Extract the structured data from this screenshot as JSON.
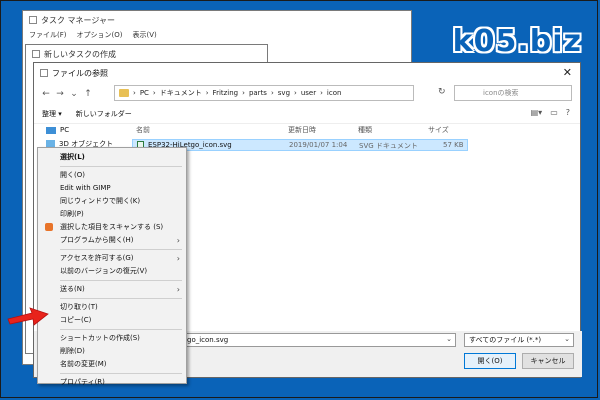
{
  "brand": "k05.biz",
  "task_manager": {
    "title": "タスク マネージャー",
    "menu": [
      "ファイル(F)",
      "オプション(O)",
      "表示(V)"
    ]
  },
  "new_task": {
    "title": "新しいタスクの作成"
  },
  "dialog": {
    "title": "ファイルの参照",
    "breadcrumb": [
      "PC",
      "ドキュメント",
      "Fritzing",
      "parts",
      "svg",
      "user",
      "icon"
    ],
    "search_placeholder": "iconの検索",
    "toolbar": {
      "organize": "整理 ▾",
      "new_folder": "新しいフォルダー"
    },
    "nav": [
      {
        "label": "PC",
        "icon": "pc-icon"
      },
      {
        "label": "3D オブジェクト",
        "icon": "3d-objects-icon"
      }
    ],
    "columns": {
      "name": "名前",
      "date": "更新日時",
      "type": "種類",
      "size": "サイズ"
    },
    "files": [
      {
        "name": "ESP32-HiLetgo_icon.svg",
        "date": "2019/01/07 1:04",
        "type": "SVG ドキュメント",
        "size": "57 KB"
      }
    ],
    "filename_value": "go_icon.svg",
    "filetype": "すべてのファイル (*.*)",
    "open_label": "開く(O)",
    "cancel_label": "キャンセル"
  },
  "context_menu": {
    "items": [
      {
        "label": "選択(L)",
        "bold": true
      },
      {
        "sep": true
      },
      {
        "label": "開く(O)"
      },
      {
        "label": "Edit with GIMP"
      },
      {
        "label": "同じウィンドウで開く(K)"
      },
      {
        "label": "印刷(P)"
      },
      {
        "label": "選択した項目をスキャンする (S)",
        "icon": "shield-icon"
      },
      {
        "label": "プログラムから開く(H)",
        "submenu": true
      },
      {
        "sep": true
      },
      {
        "label": "アクセスを許可する(G)",
        "submenu": true
      },
      {
        "label": "以前のバージョンの復元(V)"
      },
      {
        "sep": true
      },
      {
        "label": "送る(N)",
        "submenu": true
      },
      {
        "sep": true
      },
      {
        "label": "切り取り(T)"
      },
      {
        "label": "コピー(C)"
      },
      {
        "sep": true
      },
      {
        "label": "ショートカットの作成(S)"
      },
      {
        "label": "削除(D)"
      },
      {
        "label": "名前の変更(M)"
      },
      {
        "sep": true
      },
      {
        "label": "プロパティ(R)"
      }
    ]
  },
  "colors": {
    "background": "#0a63b8",
    "arrow": "#e8231b",
    "selection": "#cce8ff"
  }
}
